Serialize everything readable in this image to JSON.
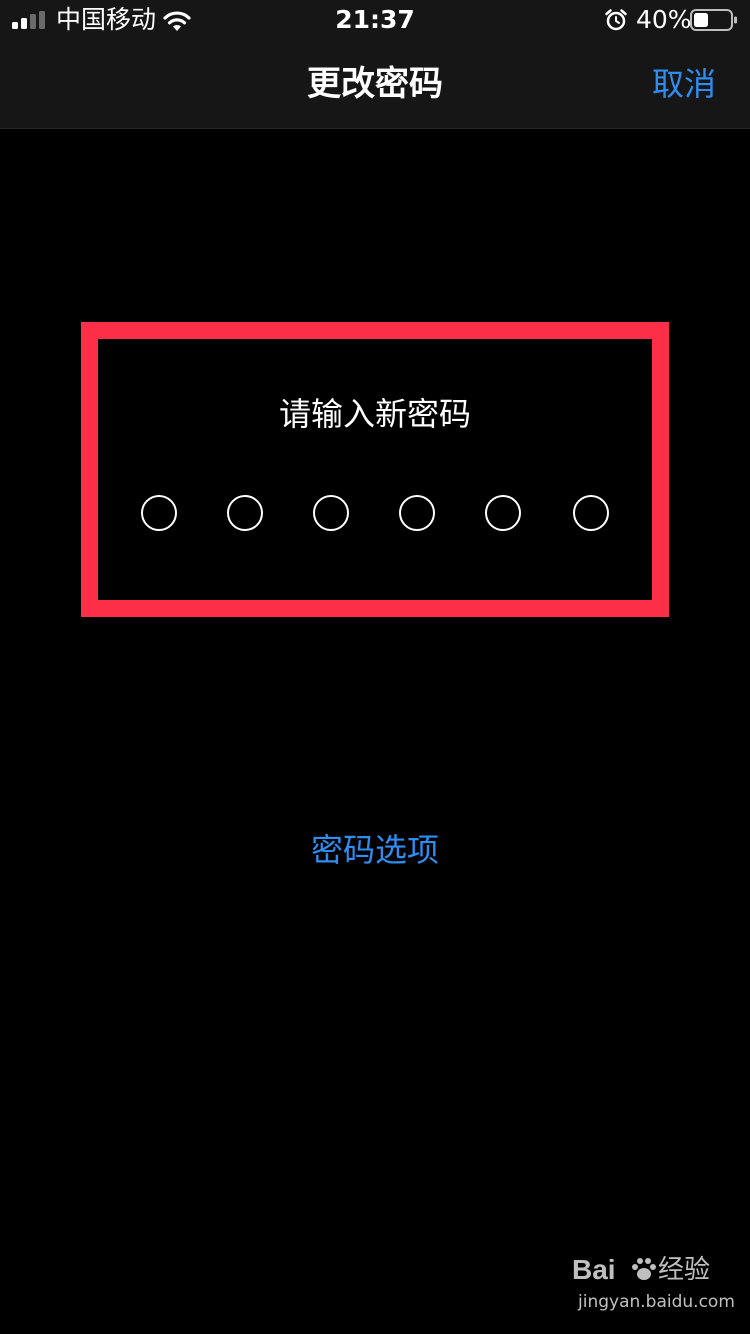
{
  "status_bar": {
    "carrier": "中国移动",
    "time": "21:37",
    "battery_percent": "40%",
    "signal_icon": "signal-bars-icon",
    "wifi_icon": "wifi-icon",
    "alarm_icon": "alarm-clock-icon",
    "battery_icon": "battery-icon",
    "battery_level": 0.4
  },
  "nav": {
    "title": "更改密码",
    "cancel_label": "取消"
  },
  "passcode": {
    "prompt": "请输入新密码",
    "digits_total": 6,
    "digits_entered": 0,
    "options_label": "密码选项"
  },
  "watermark": {
    "logo_text": "Bai",
    "logo_tail": "经验",
    "url": "jingyan.baidu.com"
  },
  "colors": {
    "accent": "#2f8df2",
    "highlight": "#fd2f48",
    "background": "#000000",
    "bar_background": "#161616"
  }
}
